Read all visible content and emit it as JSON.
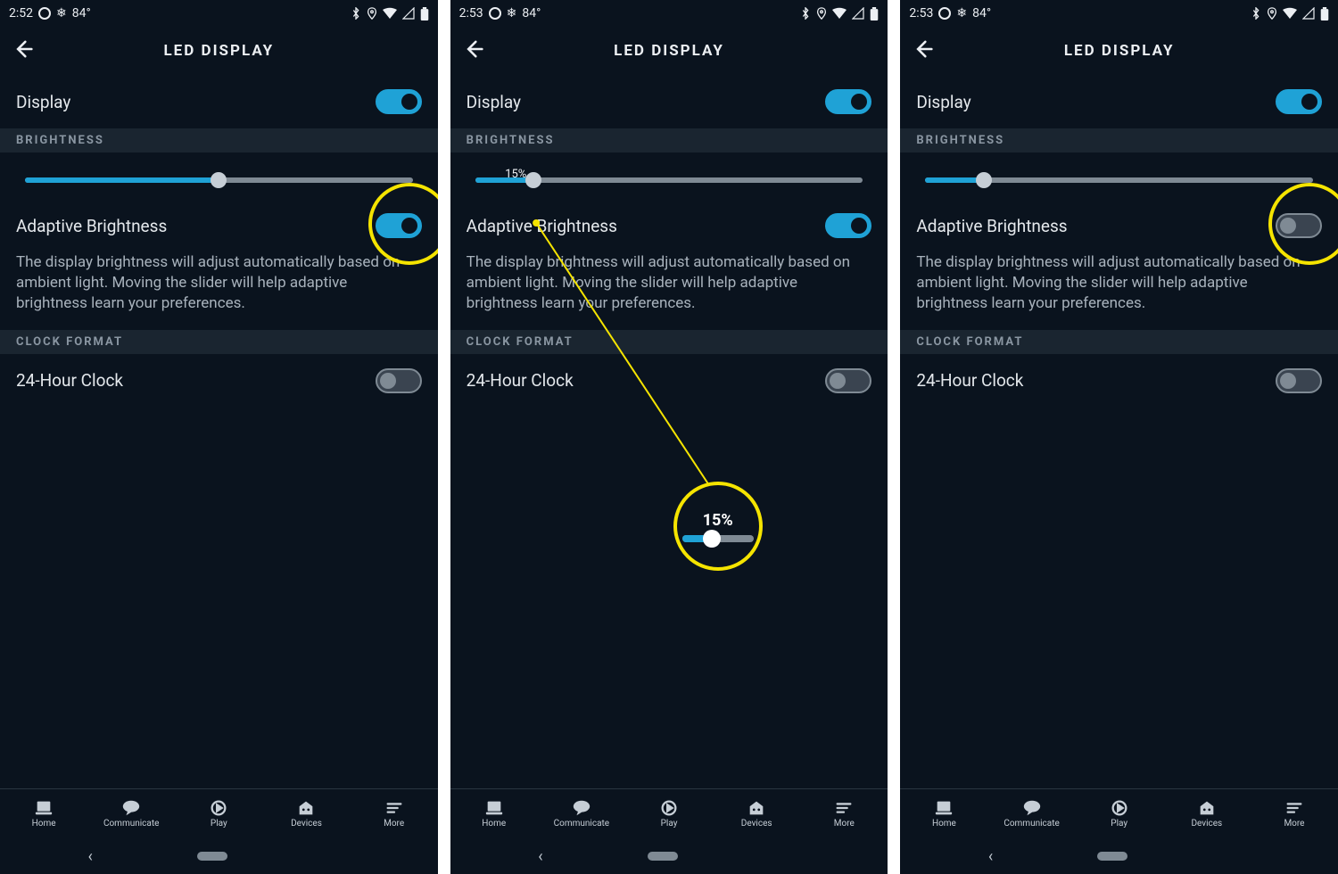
{
  "panels": [
    {
      "time": "2:52",
      "temp": "84°",
      "title": "LED DISPLAY",
      "display_label": "Display",
      "display_on": true,
      "brightness_header": "BRIGHTNESS",
      "brightness_pct": 50,
      "brightness_tip_visible": false,
      "adaptive_label": "Adaptive Brightness",
      "adaptive_on": true,
      "adaptive_circled": true,
      "desc": "The display brightness will adjust automatically based on ambient light. Moving the slider will help adaptive brightness learn your preferences.",
      "clock_header": "CLOCK FORMAT",
      "clock24_label": "24-Hour Clock",
      "clock24_on": false,
      "show_magnifier": false,
      "magnifier_label": ""
    },
    {
      "time": "2:53",
      "temp": "84°",
      "title": "LED DISPLAY",
      "display_label": "Display",
      "display_on": true,
      "brightness_header": "BRIGHTNESS",
      "brightness_pct": 15,
      "brightness_tip_visible": true,
      "adaptive_label": "Adaptive Brightness",
      "adaptive_on": true,
      "adaptive_circled": false,
      "desc": "The display brightness will adjust automatically based on ambient light. Moving the slider will help adaptive brightness learn your preferences.",
      "clock_header": "CLOCK FORMAT",
      "clock24_label": "24-Hour Clock",
      "clock24_on": false,
      "show_magnifier": true,
      "magnifier_label": "15%"
    },
    {
      "time": "2:53",
      "temp": "84°",
      "title": "LED DISPLAY",
      "display_label": "Display",
      "display_on": true,
      "brightness_header": "BRIGHTNESS",
      "brightness_pct": 15,
      "brightness_tip_visible": false,
      "adaptive_label": "Adaptive Brightness",
      "adaptive_on": false,
      "adaptive_circled": true,
      "desc": "The display brightness will adjust automatically based on ambient light. Moving the slider will help adaptive brightness learn your preferences.",
      "clock_header": "CLOCK FORMAT",
      "clock24_label": "24-Hour Clock",
      "clock24_on": false,
      "show_magnifier": false,
      "magnifier_label": ""
    }
  ],
  "nav": {
    "items": [
      {
        "label": "Home"
      },
      {
        "label": "Communicate"
      },
      {
        "label": "Play"
      },
      {
        "label": "Devices"
      },
      {
        "label": "More"
      }
    ]
  }
}
